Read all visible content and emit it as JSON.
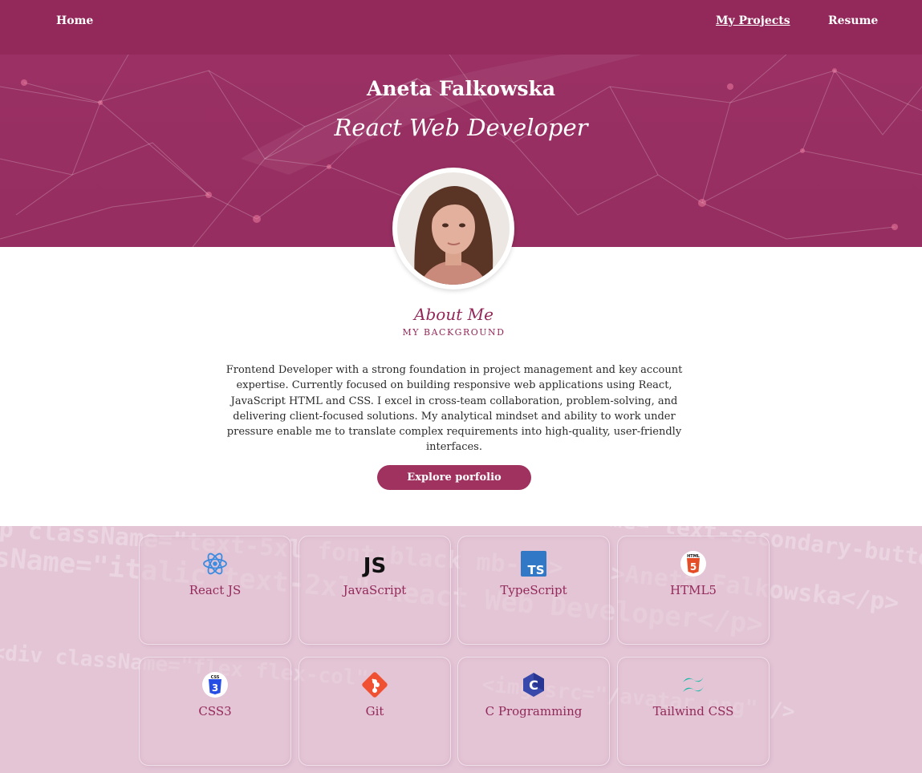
{
  "nav": {
    "home": "Home",
    "projects": "My Projects",
    "resume": "Resume"
  },
  "hero": {
    "name": "Aneta Falkowska",
    "role": "React Web Developer"
  },
  "avatar": {
    "icon": "profile-photo"
  },
  "about": {
    "title": "About Me",
    "subtitle": "MY BACKGROUND",
    "text": "Frontend Developer with a strong foundation in project management and key account expertise. Currently focused on building responsive web applications using React, JavaScript HTML and CSS. I excel in cross-team collaboration, problem-solving, and delivering client-focused solutions. My analytical mindset and ability to work under pressure enable me to translate complex requirements into high-quality, user-friendly interfaces.",
    "cta": "Explore porfolio"
  },
  "skills": [
    {
      "label": "React JS",
      "icon": "react-icon"
    },
    {
      "label": "JavaScript",
      "icon": "javascript-icon"
    },
    {
      "label": "TypeScript",
      "icon": "typescript-icon"
    },
    {
      "label": "HTML5",
      "icon": "html5-icon"
    },
    {
      "label": "CSS3",
      "icon": "css3-icon"
    },
    {
      "label": "Git",
      "icon": "git-icon"
    },
    {
      "label": "C Programming",
      "icon": "c-icon"
    },
    {
      "label": "Tailwind CSS",
      "icon": "tailwind-icon"
    }
  ],
  "colors": {
    "brand": "#93285a",
    "button": "#a0325f",
    "skills_bg": "#e3c5d6"
  }
}
